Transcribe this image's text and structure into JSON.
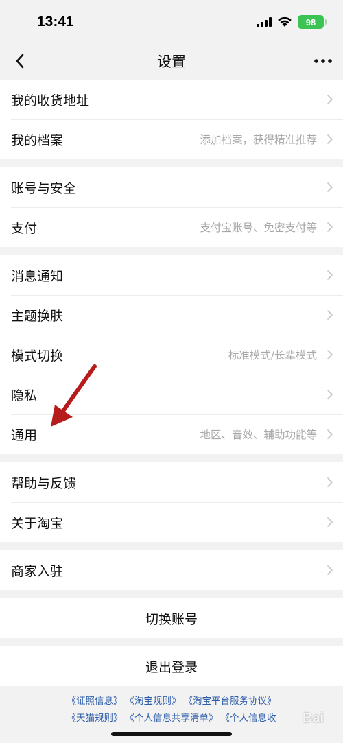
{
  "status_bar": {
    "time": "13:41",
    "battery": "98",
    "icons": [
      "signal-icon",
      "wifi-icon",
      "battery-icon"
    ]
  },
  "nav": {
    "title": "设置",
    "back_icon": "chevron-left-icon",
    "more_icon": "more-dots-icon"
  },
  "groups": [
    {
      "items": [
        {
          "label": "我的收货地址",
          "hint": ""
        },
        {
          "label": "我的档案",
          "hint": "添加档案，获得精准推荐"
        }
      ]
    },
    {
      "items": [
        {
          "label": "账号与安全",
          "hint": ""
        },
        {
          "label": "支付",
          "hint": "支付宝账号、免密支付等"
        }
      ]
    },
    {
      "items": [
        {
          "label": "消息通知",
          "hint": ""
        },
        {
          "label": "主题换肤",
          "hint": ""
        },
        {
          "label": "模式切换",
          "hint": "标准模式/长辈模式"
        },
        {
          "label": "隐私",
          "hint": ""
        },
        {
          "label": "通用",
          "hint": "地区、音效、辅助功能等"
        }
      ]
    },
    {
      "items": [
        {
          "label": "帮助与反馈",
          "hint": ""
        },
        {
          "label": "关于淘宝",
          "hint": ""
        }
      ]
    },
    {
      "items": [
        {
          "label": "商家入驻",
          "hint": ""
        }
      ]
    }
  ],
  "actions": {
    "switch_account": "切换账号",
    "logout": "退出登录"
  },
  "footer": {
    "line1": [
      "《证照信息》",
      "《淘宝规则》",
      "《淘宝平台服务协议》"
    ],
    "line2": [
      "《天猫规则》",
      "《个人信息共享清单》",
      "《个人信息收"
    ]
  },
  "watermark": "Bai",
  "colors": {
    "background": "#f2f2f2",
    "battery": "#3bc353",
    "link": "#2f5faa",
    "hint": "#a8a8a8",
    "arrow": "#b71c1c"
  }
}
